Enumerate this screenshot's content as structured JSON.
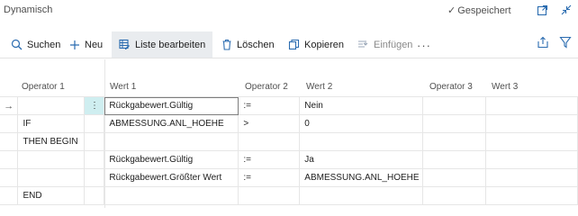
{
  "window": {
    "title": "Dynamisch",
    "saved_label": "Gespeichert"
  },
  "toolbar": {
    "search_label": "Suchen",
    "new_label": "Neu",
    "edit_list_label": "Liste bearbeiten",
    "delete_label": "Löschen",
    "copy_label": "Kopieren",
    "paste_label": "Einfügen",
    "more_label": "···"
  },
  "columns": {
    "operator1": "Operator 1",
    "wert1": "Wert 1",
    "operator2": "Operator 2",
    "wert2": "Wert 2",
    "operator3": "Operator 3",
    "wert3": "Wert 3"
  },
  "rows": [
    {
      "marker": "→",
      "operator1": "",
      "wert1": "Rückgabewert.Gültig",
      "operator2": ":=",
      "wert2": "Nein",
      "operator3": "",
      "wert3": ""
    },
    {
      "marker": "",
      "operator1": "IF",
      "wert1": "ABMESSUNG.ANL_HOEHE",
      "operator2": ">",
      "wert2": "0",
      "operator3": "",
      "wert3": ""
    },
    {
      "marker": "",
      "operator1": "THEN BEGIN",
      "wert1": "",
      "operator2": "",
      "wert2": "",
      "operator3": "",
      "wert3": ""
    },
    {
      "marker": "",
      "operator1": "",
      "wert1": "Rückgabewert.Gültig",
      "operator2": ":=",
      "wert2": "Ja",
      "operator3": "",
      "wert3": ""
    },
    {
      "marker": "",
      "operator1": "",
      "wert1": "Rückgabewert.Größter Wert",
      "operator2": ":=",
      "wert2": "ABMESSUNG.ANL_HOEHE",
      "operator3": "",
      "wert3": ""
    },
    {
      "marker": "",
      "operator1": "END",
      "wert1": "",
      "operator2": "",
      "wert2": "",
      "operator3": "",
      "wert3": ""
    }
  ],
  "row_menu_glyph": "⋮"
}
